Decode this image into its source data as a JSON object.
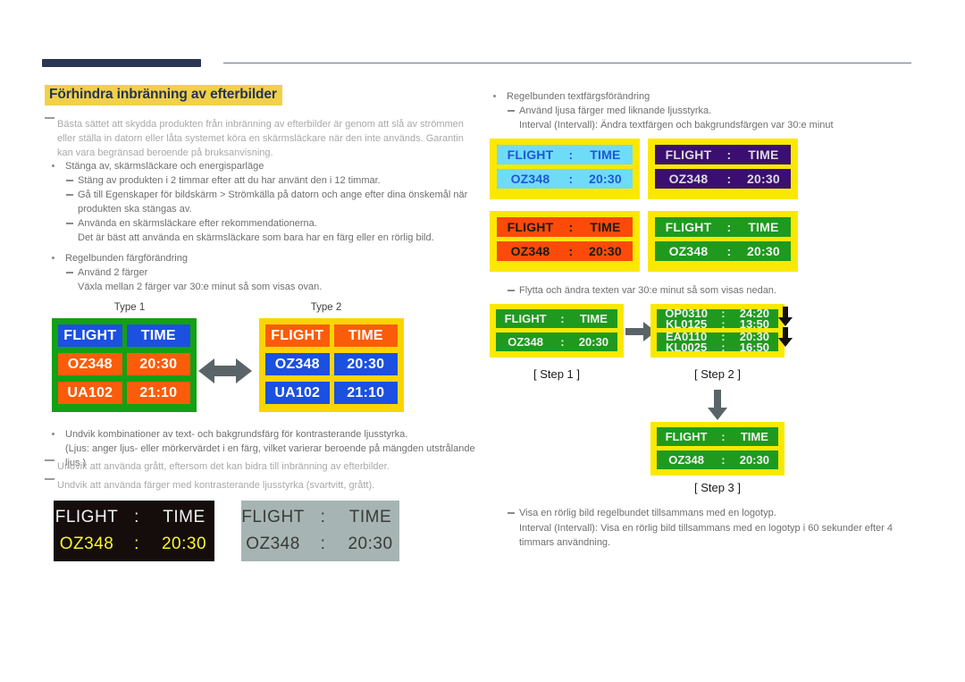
{
  "header": {
    "title": "Förhindra inbränning av efterbilder",
    "title_highlight_color": "#f2d049",
    "title_text_color": "#253354",
    "bar_color": "#2b3655"
  },
  "left_column": {
    "intro_note": "Bästa sättet att skydda produkten från inbränning av efterbilder är genom att slå av strömmen eller ställa in datorn eller låta systemet köra en skärmsläckare när den inte används. Garantin kan vara begränsad beroende på bruksanvisning.",
    "bullet1": "Stänga av, skärmsläckare och energisparläge",
    "sub1": "Stäng av produkten i 2 timmar efter att du har använt den i 12 timmar.",
    "sub2": "Gå till Egenskaper för bildskärm > Strömkälla på datorn och ange efter dina önskemål när produkten ska stängas av.",
    "sub3": "Använda en skärmsläckare efter rekommendationerna.",
    "sub3_cont": "Det är bäst att använda en skärmsläckare som bara har en färg eller en rörlig bild.",
    "bullet2": "Regelbunden färgförändring",
    "sub4": "Använd 2 färger",
    "sub4_cont": "Växla mellan 2 färger var 30:e minut så som visas ovan.",
    "bullet3": "Undvik kombinationer av text- och bakgrundsfärg för kontrasterande ljusstyrka.",
    "bullet3_cont": "(Ljus: anger ljus- eller mörkervärdet i en färg, vilket varierar beroende på mängden utstrålande ljus.)",
    "note2": "Undvik att använda grått, eftersom det kan bidra till inbränning av efterbilder.",
    "note3": "Undvik att använda färger med kontrasterande ljusstyrka (svartvitt, grått)."
  },
  "type_boards": {
    "type1_label": "Type 1",
    "type2_label": "Type 2",
    "headers": [
      "FLIGHT",
      "TIME"
    ],
    "rows": [
      [
        "OZ348",
        "20:30"
      ],
      [
        "UA102",
        "21:10"
      ]
    ],
    "type1_frame_color": "#14a014",
    "type2_frame_color": "#fbd501",
    "blue": "#1c50e0",
    "orange": "#fb5c0a",
    "arrow": "double-arrow-icon"
  },
  "contrast_panels": {
    "black": {
      "row1": {
        "k": "FLIGHT",
        "sep": ":",
        "v": "TIME"
      },
      "row2": {
        "k": "OZ348",
        "sep": ":",
        "v": "20:30"
      },
      "bg": "#140d0c",
      "row1_color": "#f4f4f4",
      "row2_color": "#fbf724"
    },
    "gray": {
      "row1": {
        "k": "FLIGHT",
        "sep": ":",
        "v": "TIME"
      },
      "row2": {
        "k": "OZ348",
        "sep": ":",
        "v": "20:30"
      },
      "bg": "#a6b5b3",
      "text_color": "#3a3a3a"
    }
  },
  "right_column": {
    "bullet1": "Regelbunden textfärgsförändring",
    "sub1": "Använd ljusa färger med liknande ljusstyrka.",
    "sub1_cont": "Interval (Intervall): Ändra textfärgen och bakgrundsfärgen var 30:e minut",
    "sub2": "Flytta och ändra texten var 30:e minut så som visas nedan.",
    "sub3": "Visa en rörlig bild regelbundet tillsammans med en logotyp.",
    "sub3_cont": "Interval (Intervall): Visa en rörlig bild tillsammans med en logotyp i 60 sekunder efter 4 timmars användning."
  },
  "color_panels": {
    "frame": "#fbe800",
    "items": [
      {
        "name": "cyan",
        "bg": "#6fdcf7",
        "fg": "#2255d8",
        "row1": {
          "k": "FLIGHT",
          "sep": ":",
          "v": "TIME"
        },
        "row2": {
          "k": "OZ348",
          "sep": ":",
          "v": "20:30"
        }
      },
      {
        "name": "purple",
        "bg": "#3b0f72",
        "fg": "#dcdcdc",
        "row1": {
          "k": "FLIGHT",
          "sep": ":",
          "v": "TIME"
        },
        "row2": {
          "k": "OZ348",
          "sep": ":",
          "v": "20:30"
        }
      },
      {
        "name": "orange",
        "bg": "#fb4a0a",
        "fg": "#1a1a1a",
        "row1": {
          "k": "FLIGHT",
          "sep": ":",
          "v": "TIME"
        },
        "row2": {
          "k": "OZ348",
          "sep": ":",
          "v": "20:30"
        }
      },
      {
        "name": "green",
        "bg": "#1f9a1f",
        "fg": "#f2f2f2",
        "row1": {
          "k": "FLIGHT",
          "sep": ":",
          "v": "TIME"
        },
        "row2": {
          "k": "OZ348",
          "sep": ":",
          "v": "20:30"
        }
      }
    ]
  },
  "steps": {
    "step1": {
      "label": "[ Step 1 ]",
      "row1": {
        "k": "FLIGHT",
        "sep": ":",
        "v": "TIME"
      },
      "row2": {
        "k": "OZ348",
        "sep": ":",
        "v": "20:30"
      }
    },
    "step2": {
      "label": "[ Step 2 ]",
      "line1_top": {
        "k": "OP0310",
        "sep": ":",
        "v": "24:20"
      },
      "line1_bottom": {
        "k": "KL0125",
        "sep": ":",
        "v": "13:50"
      },
      "line2_top": {
        "k": "EA0110",
        "sep": ":",
        "v": "20:30"
      },
      "line2_bottom": {
        "k": "KL0025",
        "sep": ":",
        "v": "16:50"
      }
    },
    "step3": {
      "label": "[ Step 3 ]",
      "row1": {
        "k": "FLIGHT",
        "sep": ":",
        "v": "TIME"
      },
      "row2": {
        "k": "OZ348",
        "sep": ":",
        "v": "20:30"
      }
    }
  }
}
